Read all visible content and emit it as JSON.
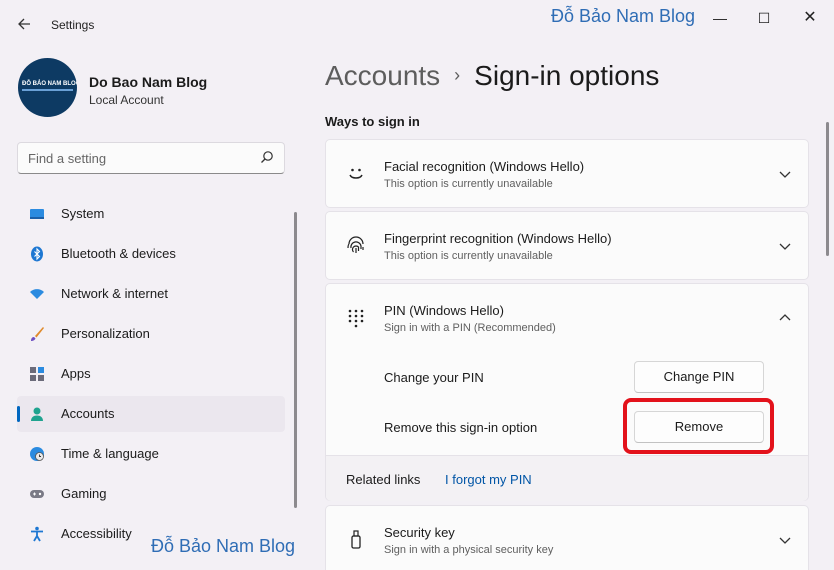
{
  "window": {
    "title": "Settings",
    "watermark": "Đỗ Bảo Nam Blog",
    "minimize": "—",
    "maximize": "☐",
    "close": "✕"
  },
  "profile": {
    "name": "Do Bao Nam Blog",
    "account_type": "Local Account",
    "avatar_text": "ĐỖ BẢO NAM BLOG"
  },
  "search": {
    "placeholder": "Find a setting"
  },
  "sidebar": {
    "items": [
      {
        "label": "System",
        "icon": "monitor-icon"
      },
      {
        "label": "Bluetooth & devices",
        "icon": "bluetooth-icon"
      },
      {
        "label": "Network & internet",
        "icon": "wifi-icon"
      },
      {
        "label": "Personalization",
        "icon": "brush-icon"
      },
      {
        "label": "Apps",
        "icon": "apps-icon"
      },
      {
        "label": "Accounts",
        "icon": "person-icon",
        "active": true
      },
      {
        "label": "Time & language",
        "icon": "globe-clock-icon"
      },
      {
        "label": "Gaming",
        "icon": "gamepad-icon"
      },
      {
        "label": "Accessibility",
        "icon": "accessibility-icon"
      }
    ]
  },
  "watermark_bottom": "Đỗ Bảo Nam Blog",
  "header": {
    "parent": "Accounts",
    "separator": "›",
    "current": "Sign-in options"
  },
  "section_title": "Ways to sign in",
  "options": {
    "facial": {
      "title": "Facial recognition (Windows Hello)",
      "subtitle": "This option is currently unavailable",
      "icon": "smile-face-icon"
    },
    "fingerprint": {
      "title": "Fingerprint recognition (Windows Hello)",
      "subtitle": "This option is currently unavailable",
      "icon": "fingerprint-icon"
    },
    "pin": {
      "title": "PIN (Windows Hello)",
      "subtitle": "Sign in with a PIN (Recommended)",
      "icon": "keypad-icon",
      "change_label": "Change your PIN",
      "change_button": "Change PIN",
      "remove_label": "Remove this sign-in option",
      "remove_button": "Remove",
      "related_label": "Related links",
      "related_link": "I forgot my PIN"
    },
    "security_key": {
      "title": "Security key",
      "subtitle": "Sign in with a physical security key",
      "icon": "usb-key-icon"
    }
  },
  "colors": {
    "accent": "#0067c0",
    "highlight": "#e3121b",
    "link": "#0055a6",
    "watermark": "#2f6db5"
  }
}
